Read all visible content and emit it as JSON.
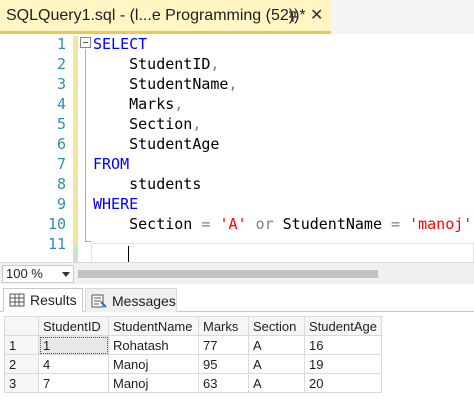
{
  "tab": {
    "title": "SQLQuery1.sql - (l...e Programming (52))*",
    "close_glyph": "✕",
    "pin_icon": "pin-icon"
  },
  "editor": {
    "line_numbers": [
      "1",
      "2",
      "3",
      "4",
      "5",
      "6",
      "7",
      "8",
      "9",
      "10",
      "11"
    ],
    "lines": [
      [
        {
          "t": "SELECT",
          "c": "kw"
        }
      ],
      [
        {
          "t": "    StudentID",
          "c": ""
        },
        {
          "t": ",",
          "c": "op"
        }
      ],
      [
        {
          "t": "    StudentName",
          "c": ""
        },
        {
          "t": ",",
          "c": "op"
        }
      ],
      [
        {
          "t": "    Marks",
          "c": ""
        },
        {
          "t": ",",
          "c": "op"
        }
      ],
      [
        {
          "t": "    Section",
          "c": ""
        },
        {
          "t": ",",
          "c": "op"
        }
      ],
      [
        {
          "t": "    StudentAge",
          "c": ""
        }
      ],
      [
        {
          "t": "FROM",
          "c": "kw"
        }
      ],
      [
        {
          "t": "    students",
          "c": ""
        }
      ],
      [
        {
          "t": "WHERE",
          "c": "kw"
        }
      ],
      [
        {
          "t": "    Section ",
          "c": ""
        },
        {
          "t": "=",
          "c": "op"
        },
        {
          "t": " ",
          "c": ""
        },
        {
          "t": "'A'",
          "c": "str"
        },
        {
          "t": " ",
          "c": ""
        },
        {
          "t": "or",
          "c": "op"
        },
        {
          "t": " StudentName ",
          "c": ""
        },
        {
          "t": "=",
          "c": "op"
        },
        {
          "t": " ",
          "c": ""
        },
        {
          "t": "'manoj'",
          "c": "str"
        }
      ],
      [
        {
          "t": "",
          "c": ""
        }
      ]
    ],
    "colors": {
      "keyword": "#0000ff",
      "string": "#ff0000",
      "operator": "#808080",
      "line_number": "#2b91af"
    }
  },
  "zoom": {
    "value": "100 %"
  },
  "results_tabs": [
    {
      "label": "Results",
      "icon": "grid-icon"
    },
    {
      "label": "Messages",
      "icon": "messages-icon"
    }
  ],
  "grid": {
    "columns": [
      "StudentID",
      "StudentName",
      "Marks",
      "Section",
      "StudentAge"
    ],
    "rows": [
      {
        "num": "1",
        "cells": [
          "1",
          "Rohatash",
          "77",
          "A",
          "16"
        ]
      },
      {
        "num": "2",
        "cells": [
          "4",
          "Manoj",
          "95",
          "A",
          "19"
        ]
      },
      {
        "num": "3",
        "cells": [
          "7",
          "Manoj",
          "63",
          "A",
          "20"
        ]
      }
    ]
  }
}
